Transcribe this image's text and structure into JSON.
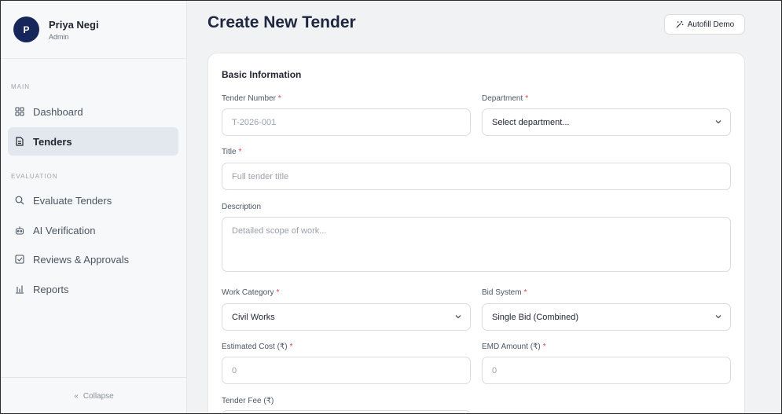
{
  "user": {
    "initial": "P",
    "name": "Priya Negi",
    "role": "Admin"
  },
  "sidebar": {
    "section_main": "MAIN",
    "section_evaluation": "EVALUATION",
    "items": [
      {
        "label": "Dashboard",
        "icon": "grid-icon",
        "active": false
      },
      {
        "label": "Tenders",
        "icon": "document-icon",
        "active": true
      },
      {
        "label": "Evaluate Tenders",
        "icon": "search-icon",
        "active": false
      },
      {
        "label": "AI Verification",
        "icon": "robot-icon",
        "active": false
      },
      {
        "label": "Reviews & Approvals",
        "icon": "checkbox-icon",
        "active": false
      },
      {
        "label": "Reports",
        "icon": "bar-chart-icon",
        "active": false
      }
    ],
    "collapse_label": "Collapse"
  },
  "header": {
    "title": "Create New Tender",
    "autofill_label": "Autofill Demo"
  },
  "form": {
    "section_title": "Basic Information",
    "tender_number": {
      "label": "Tender Number",
      "placeholder": "T-2026-001"
    },
    "department": {
      "label": "Department",
      "value": "Select department..."
    },
    "title": {
      "label": "Title",
      "placeholder": "Full tender title"
    },
    "description": {
      "label": "Description",
      "placeholder": "Detailed scope of work..."
    },
    "work_category": {
      "label": "Work Category",
      "value": "Civil Works"
    },
    "bid_system": {
      "label": "Bid System",
      "value": "Single Bid (Combined)"
    },
    "estimated_cost": {
      "label": "Estimated Cost (₹)",
      "placeholder": "0"
    },
    "emd_amount": {
      "label": "EMD Amount (₹)",
      "placeholder": "0"
    },
    "tender_fee": {
      "label": "Tender Fee (₹)"
    },
    "required_mark": "*"
  },
  "colors": {
    "accent": "#16265a",
    "required": "#e0444a",
    "active_bg": "#e3e8ef"
  }
}
